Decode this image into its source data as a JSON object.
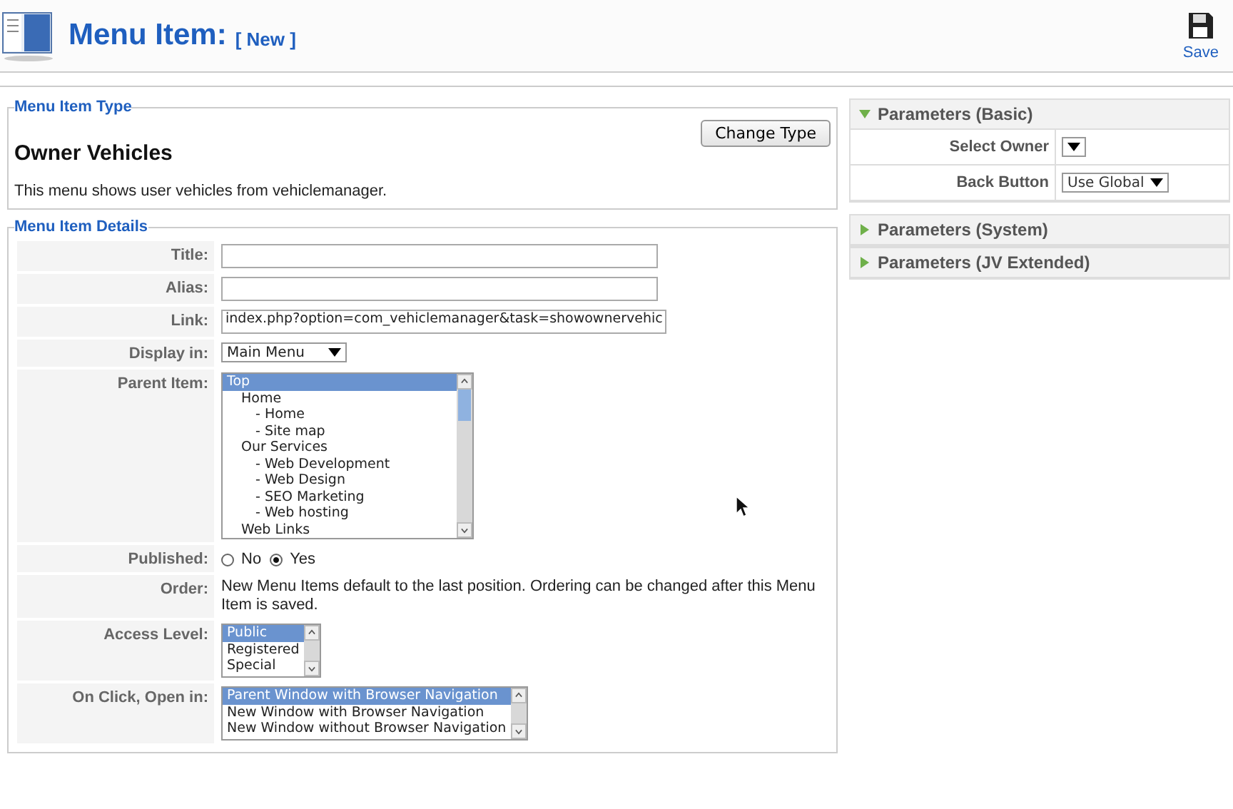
{
  "header": {
    "title": "Menu Item:",
    "subtitle": "[ New ]",
    "save": "Save"
  },
  "menu_item_type": {
    "legend": "Menu Item Type",
    "button": "Change Type",
    "name": "Owner Vehicles",
    "description": "This menu shows user vehicles from vehiclemanager."
  },
  "details": {
    "legend": "Menu Item Details",
    "rows": [
      {
        "kind": "text",
        "label": "Title:",
        "value": ""
      },
      {
        "kind": "text",
        "label": "Alias:",
        "value": ""
      },
      {
        "kind": "text",
        "label": "Link:",
        "value": "index.php?option=com_vehiclemanager&task=showownervehic"
      },
      {
        "kind": "select",
        "label": "Display in:",
        "value": "Main Menu"
      },
      {
        "kind": "tree",
        "label": "Parent Item:",
        "items": [
          {
            "label": "Top",
            "selected": true,
            "children": [
              {
                "label": "Home",
                "selected": false,
                "children": [
                  {
                    "label": "- Home",
                    "selected": false
                  },
                  {
                    "label": "- Site map",
                    "selected": false
                  }
                ]
              },
              {
                "label": "Our Services",
                "selected": false,
                "children": [
                  {
                    "label": "- Web Development",
                    "selected": false
                  },
                  {
                    "label": "- Web Design",
                    "selected": false
                  },
                  {
                    "label": "- SEO Marketing",
                    "selected": false
                  },
                  {
                    "label": "- Web hosting",
                    "selected": false
                  }
                ]
              },
              {
                "label": "Web Links",
                "selected": false
              }
            ]
          }
        ]
      },
      {
        "kind": "radio",
        "label": "Published:",
        "options": [
          {
            "label": "No",
            "selected": false
          },
          {
            "label": "Yes",
            "selected": true
          }
        ]
      },
      {
        "kind": "note",
        "label": "Order:",
        "text": "New Menu Items default to the last position. Ordering can be changed after this Menu Item is saved."
      },
      {
        "kind": "list",
        "label": "Access Level:",
        "items": [
          {
            "label": "Public",
            "selected": true
          },
          {
            "label": "Registered",
            "selected": false
          },
          {
            "label": "Special",
            "selected": false
          }
        ]
      },
      {
        "kind": "list",
        "label": "On Click, Open in:",
        "items": [
          {
            "label": "Parent Window with Browser Navigation",
            "selected": true
          },
          {
            "label": "New Window with Browser Navigation",
            "selected": false
          },
          {
            "label": "New Window without Browser Navigation",
            "selected": false
          }
        ]
      }
    ]
  },
  "parameters": [
    {
      "title": "Parameters (Basic)",
      "expanded": true,
      "rows": [
        {
          "label": "Select Owner",
          "value": ""
        },
        {
          "label": "Back Button",
          "value": "Use Global"
        }
      ]
    },
    {
      "title": "Parameters (System)",
      "expanded": false
    },
    {
      "title": "Parameters (JV Extended)",
      "expanded": false
    }
  ]
}
